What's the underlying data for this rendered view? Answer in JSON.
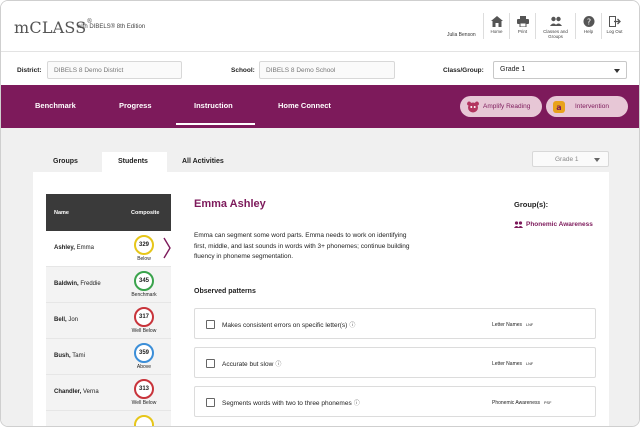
{
  "header": {
    "logo": "mCLASS",
    "logo_mark": "®",
    "logo_sub": "with DIBELS® 8th Edition",
    "user_name": "Julia Benson",
    "nav": [
      {
        "label": "Home",
        "icon": "home-icon"
      },
      {
        "label": "Print",
        "icon": "print-icon"
      },
      {
        "label": "Classes and Groups",
        "icon": "people-icon"
      },
      {
        "label": "Help",
        "icon": "help-icon"
      },
      {
        "label": "Log Out",
        "icon": "logout-icon"
      }
    ]
  },
  "filters": {
    "district_label": "District:",
    "district_value": "DIBELS 8 Demo District",
    "school_label": "School:",
    "school_value": "DIBELS 8 Demo School",
    "class_label": "Class/Group:",
    "class_value": "Grade 1"
  },
  "mainnav": {
    "tabs": [
      "Benchmark",
      "Progress",
      "Instruction",
      "Home Connect"
    ],
    "active_tab": "Instruction",
    "amplify_label": "Amplify Reading",
    "intervention_label": "Intervention"
  },
  "subtabs": {
    "items": [
      "Groups",
      "Students",
      "All Activities"
    ],
    "active": "Students",
    "grade_select": "Grade 1"
  },
  "students": {
    "header_name": "Name",
    "header_composite": "Composite",
    "rows": [
      {
        "last": "Ashley,",
        "first": "Emma",
        "score": "329",
        "level": "Below",
        "color": "#e6c619"
      },
      {
        "last": "Baldwin,",
        "first": "Freddie",
        "score": "345",
        "level": "Benchmark",
        "color": "#3aa34c"
      },
      {
        "last": "Bell,",
        "first": "Jon",
        "score": "317",
        "level": "Well Below",
        "color": "#c8343b"
      },
      {
        "last": "Bush,",
        "first": "Tami",
        "score": "359",
        "level": "Above",
        "color": "#3b8ed8"
      },
      {
        "last": "Chandler,",
        "first": "Verna",
        "score": "313",
        "level": "Well Below",
        "color": "#c8343b"
      }
    ]
  },
  "detail": {
    "name": "Emma Ashley",
    "description": "Emma can segment some word parts. Emma needs to work on identifying first, middle, and last sounds in words with 3+ phonemes; continue building fluency in phoneme segmentation.",
    "groups_heading": "Group(s):",
    "group_name": "Phonemic Awareness",
    "observed_heading": "Observed patterns",
    "patterns": [
      {
        "text": "Makes consistent errors on specific letter(s)",
        "info": "ⓘ",
        "measure": "Letter Names",
        "code": "LNF"
      },
      {
        "text": "Accurate but slow",
        "info": "ⓘ",
        "measure": "Letter Names",
        "code": "LNF"
      },
      {
        "text": "Segments words with two to three phonemes",
        "info": "ⓘ",
        "measure": "Phonemic Awareness",
        "code": "PSF"
      }
    ]
  },
  "colors": {
    "brand": "#7d1a5b",
    "pill": "#e7c7d6"
  }
}
